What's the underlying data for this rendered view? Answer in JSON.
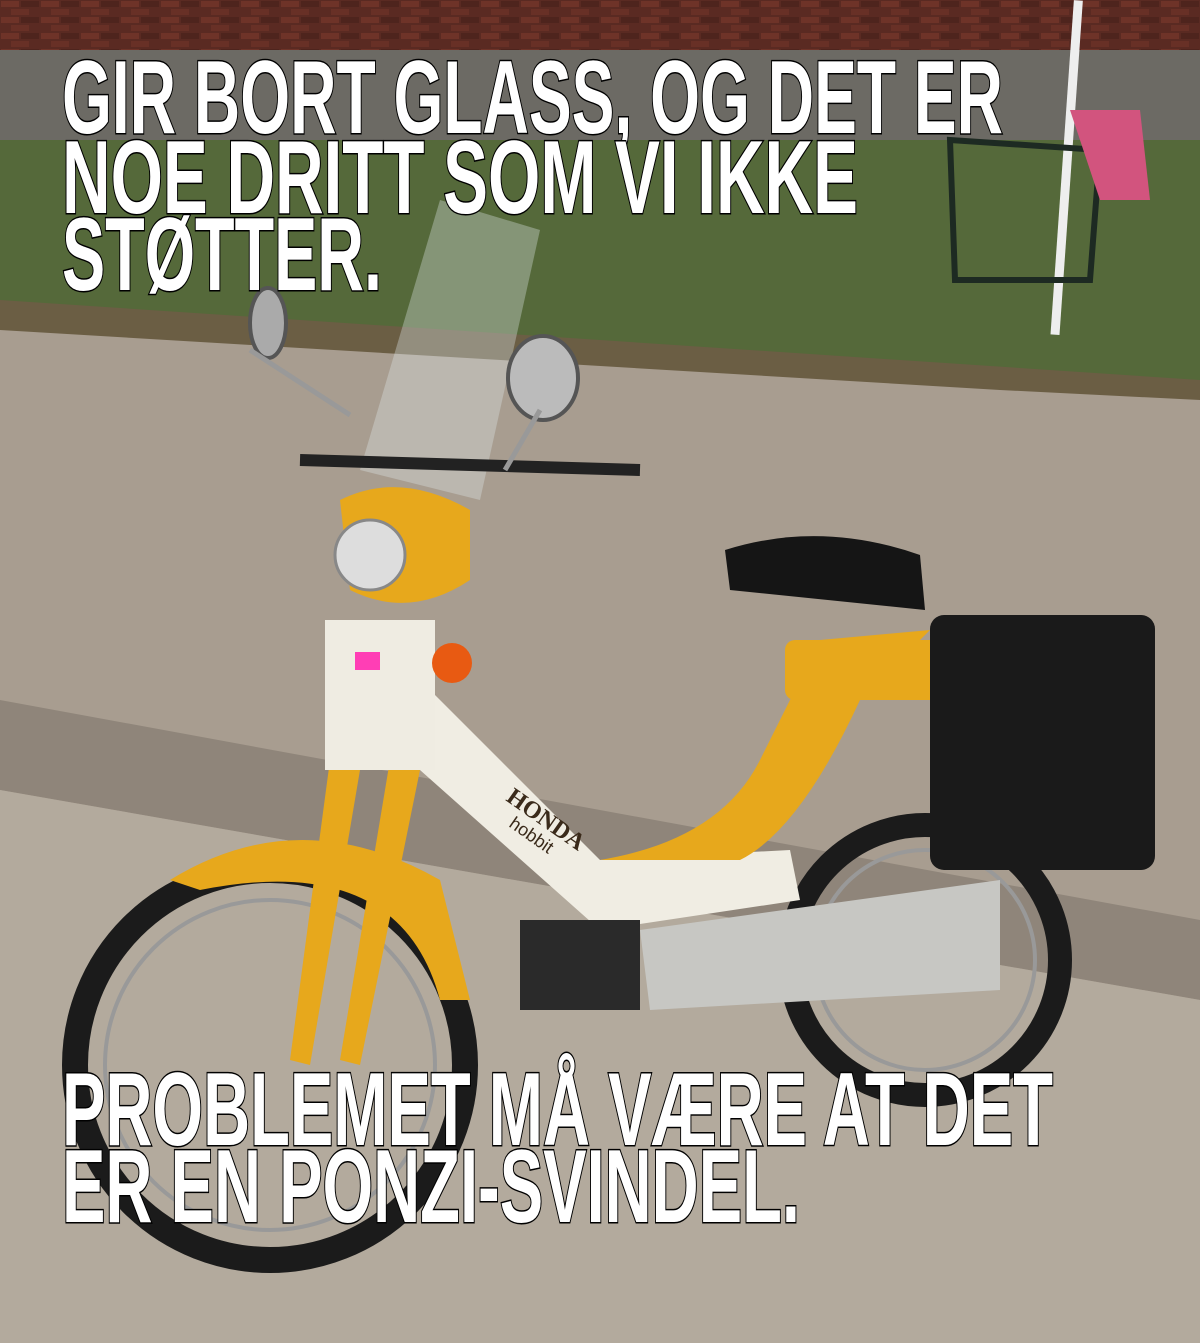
{
  "meme": {
    "top_text": [
      "GIR BORT GLASS, OG DET ER",
      "NOE DRITT SOM VI IKKE",
      "STØTTER."
    ],
    "bottom_text": [
      "PROBLEMET MÅ VÆRE AT DET",
      "ER EN PONZI-SVINDEL."
    ]
  },
  "photo": {
    "moped_brand": "HONDA",
    "moped_model": "hobbit"
  }
}
